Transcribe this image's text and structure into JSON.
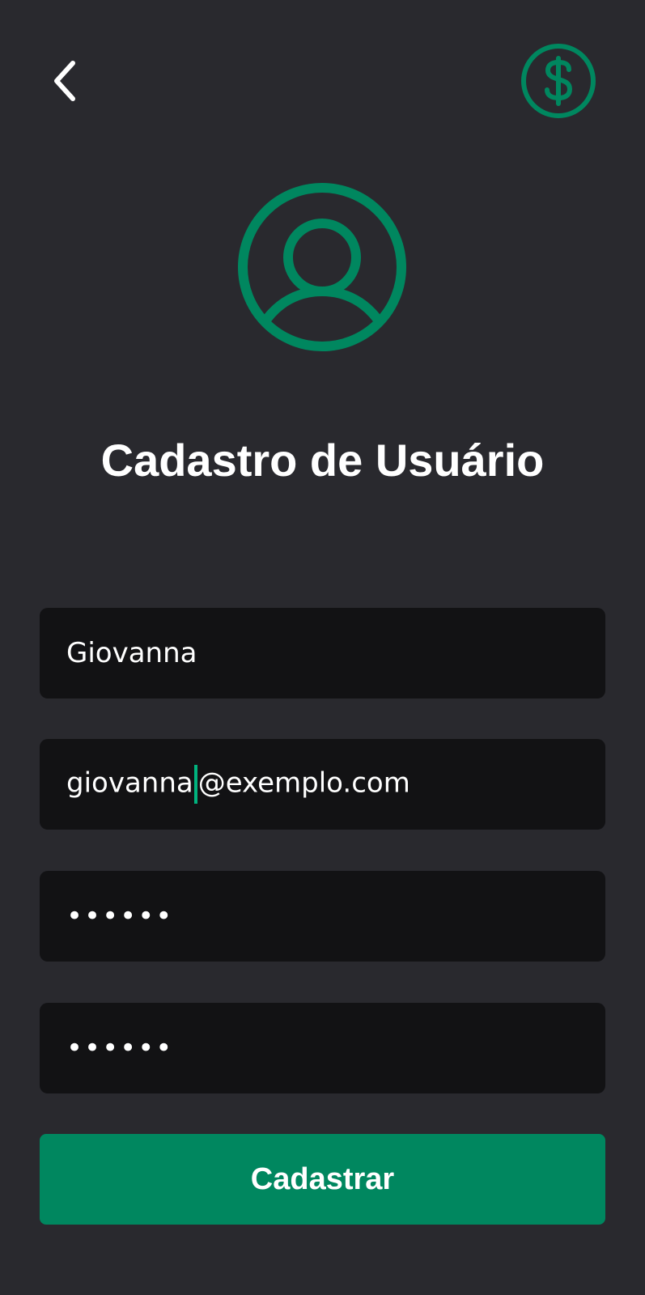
{
  "header": {
    "back_icon": "chevron-left-icon",
    "currency_icon": "dollar-circle-icon"
  },
  "avatar": {
    "icon": "user-circle-icon"
  },
  "title": "Cadastro de Usuário",
  "form": {
    "name_value": "Giovanna",
    "email_before_caret": "giovanna",
    "email_after_caret": "@exemplo.com",
    "password_value": "••••••",
    "password_confirm_value": "••••••"
  },
  "submit_label": "Cadastrar",
  "colors": {
    "background": "#29292e",
    "field_background": "#121214",
    "accent": "#00875f",
    "caret": "#00b37e",
    "text": "#ffffff"
  }
}
